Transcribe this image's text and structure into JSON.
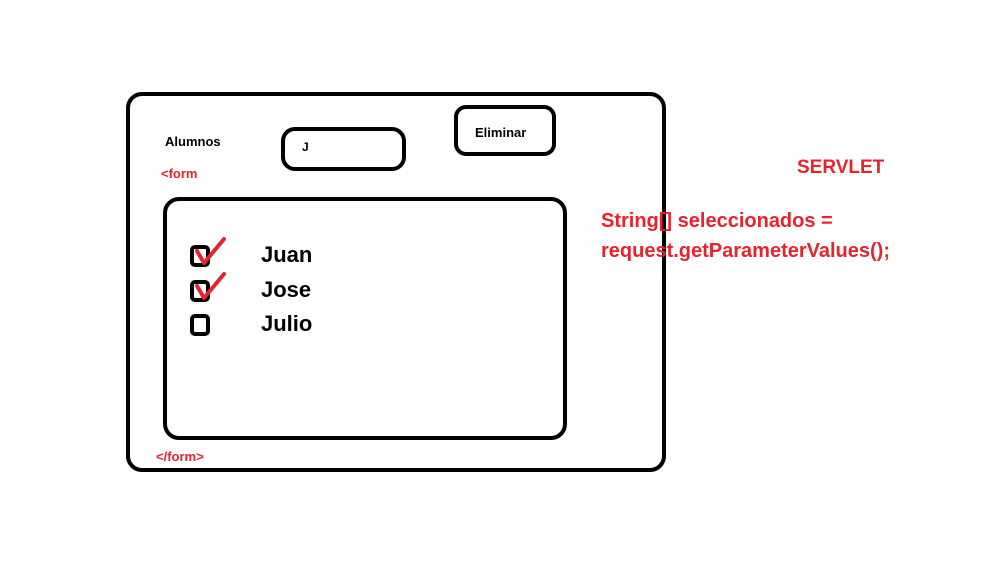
{
  "form": {
    "alumnos_label": "Alumnos",
    "search_value": "J",
    "eliminar_label": "Eliminar",
    "open_tag": "<form",
    "close_tag": "</form>"
  },
  "students": [
    {
      "name": "Juan",
      "checked": true
    },
    {
      "name": "Jose",
      "checked": true
    },
    {
      "name": "Julio",
      "checked": false
    }
  ],
  "servlet": {
    "title": "SERVLET",
    "code_lines": [
      "String[] seleccionados =",
      "request.getParameterValues();"
    ]
  },
  "colors": {
    "annotation": "#e8232d",
    "outline": "#000000"
  }
}
